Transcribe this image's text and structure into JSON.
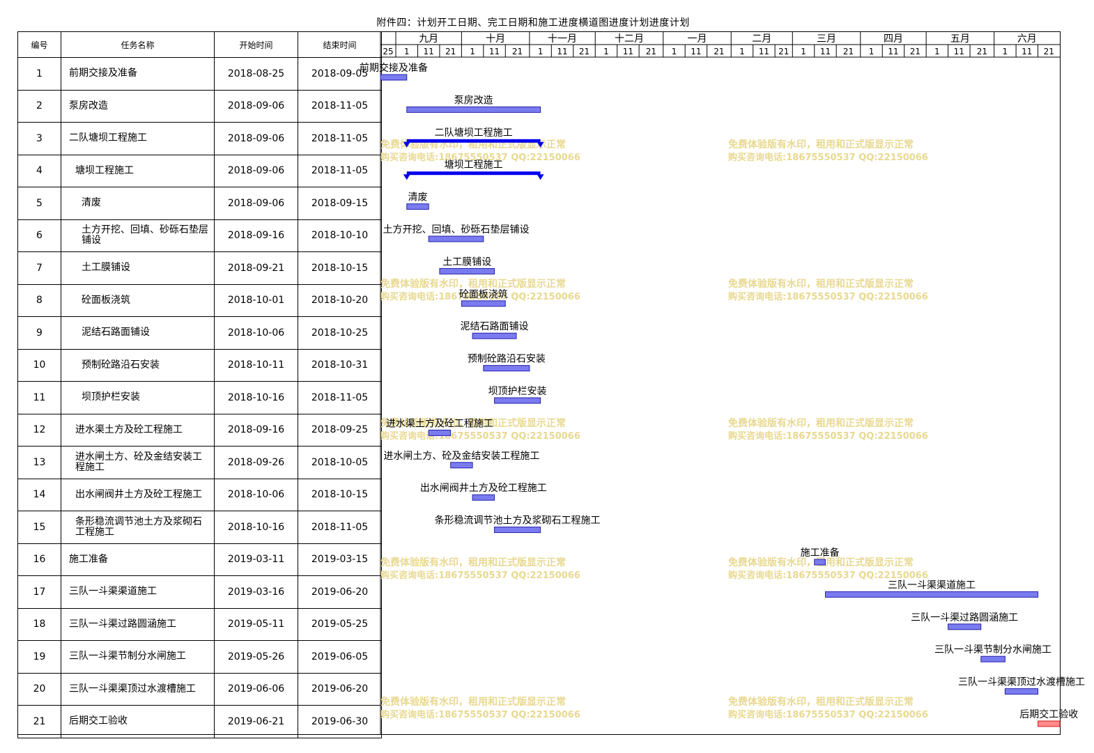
{
  "title": "附件四：计划开工日期、完工日期和施工进度横道图进度计划进度计划",
  "columns": {
    "id": "编号",
    "name": "任务名称",
    "start": "开始时间",
    "end": "结束时间"
  },
  "months": [
    "九月",
    "十月",
    "十一月",
    "十二月",
    "一月",
    "二月",
    "三月",
    "四月",
    "五月",
    "六月"
  ],
  "first_day_label": "25",
  "day_labels": [
    "1",
    "11",
    "21"
  ],
  "watermark": {
    "line1": "免费体验版有水印，租用和正式版显示正常",
    "line2": "购买咨询电话:18675550537 QQ:22150066"
  },
  "colors": {
    "task_bar": "#7b7bf0",
    "task_bar_border": "#2222aa",
    "summary_bar": "#0000ee",
    "final_bar": "#ff8a8a",
    "watermark": "#e8d890"
  },
  "tasks": [
    {
      "id": "1",
      "name": "前期交接及准备",
      "start": "2018-08-25",
      "end": "2018-09-05",
      "level": 0,
      "type": "task"
    },
    {
      "id": "2",
      "name": "泵房改造",
      "start": "2018-09-06",
      "end": "2018-11-05",
      "level": 0,
      "type": "task"
    },
    {
      "id": "3",
      "name": "二队塘坝工程施工",
      "start": "2018-09-06",
      "end": "2018-11-05",
      "level": 0,
      "type": "summary"
    },
    {
      "id": "4",
      "name": "塘坝工程施工",
      "start": "2018-09-06",
      "end": "2018-11-05",
      "level": 1,
      "type": "summary"
    },
    {
      "id": "5",
      "name": "清废",
      "start": "2018-09-06",
      "end": "2018-09-15",
      "level": 2,
      "type": "task"
    },
    {
      "id": "6",
      "name": "土方开挖、回填、砂砾石垫层铺设",
      "start": "2018-09-16",
      "end": "2018-10-10",
      "level": 2,
      "type": "task"
    },
    {
      "id": "7",
      "name": "土工膜铺设",
      "start": "2018-09-21",
      "end": "2018-10-15",
      "level": 2,
      "type": "task"
    },
    {
      "id": "8",
      "name": "砼面板浇筑",
      "start": "2018-10-01",
      "end": "2018-10-20",
      "level": 2,
      "type": "task"
    },
    {
      "id": "9",
      "name": "泥结石路面铺设",
      "start": "2018-10-06",
      "end": "2018-10-25",
      "level": 2,
      "type": "task"
    },
    {
      "id": "10",
      "name": "预制砼路沿石安装",
      "start": "2018-10-11",
      "end": "2018-10-31",
      "level": 2,
      "type": "task"
    },
    {
      "id": "11",
      "name": "坝顶护栏安装",
      "start": "2018-10-16",
      "end": "2018-11-05",
      "level": 2,
      "type": "task"
    },
    {
      "id": "12",
      "name": "进水渠土方及砼工程施工",
      "start": "2018-09-16",
      "end": "2018-09-25",
      "level": 1,
      "type": "task"
    },
    {
      "id": "13",
      "name": "进水闸土方、砼及金结安装工程施工",
      "start": "2018-09-26",
      "end": "2018-10-05",
      "level": 1,
      "type": "task"
    },
    {
      "id": "14",
      "name": "出水闸阀井土方及砼工程施工",
      "start": "2018-10-06",
      "end": "2018-10-15",
      "level": 1,
      "type": "task"
    },
    {
      "id": "15",
      "name": "条形稳流调节池土方及浆砌石工程施工",
      "start": "2018-10-16",
      "end": "2018-11-05",
      "level": 1,
      "type": "task"
    },
    {
      "id": "16",
      "name": "施工准备",
      "start": "2019-03-11",
      "end": "2019-03-15",
      "level": 0,
      "type": "task"
    },
    {
      "id": "17",
      "name": "三队一斗渠渠道施工",
      "start": "2019-03-16",
      "end": "2019-06-20",
      "level": 0,
      "type": "task"
    },
    {
      "id": "18",
      "name": "三队一斗渠过路圆涵施工",
      "start": "2019-05-11",
      "end": "2019-05-25",
      "level": 0,
      "type": "task"
    },
    {
      "id": "19",
      "name": "三队一斗渠节制分水闸施工",
      "start": "2019-05-26",
      "end": "2019-06-05",
      "level": 0,
      "type": "task"
    },
    {
      "id": "20",
      "name": "三队一斗渠渠顶过水渡槽施工",
      "start": "2019-06-06",
      "end": "2019-06-20",
      "level": 0,
      "type": "task"
    },
    {
      "id": "21",
      "name": "后期交工验收",
      "start": "2019-06-21",
      "end": "2019-06-30",
      "level": 0,
      "type": "final"
    }
  ],
  "chart_data": {
    "type": "gantt",
    "title": "附件四：计划开工日期、完工日期和施工进度横道图进度计划进度计划",
    "x_range": [
      "2018-08-25",
      "2019-06-30"
    ],
    "tasks": [
      {
        "name": "前期交接及准备",
        "start": "2018-08-25",
        "end": "2018-09-05"
      },
      {
        "name": "泵房改造",
        "start": "2018-09-06",
        "end": "2018-11-05"
      },
      {
        "name": "二队塘坝工程施工",
        "start": "2018-09-06",
        "end": "2018-11-05"
      },
      {
        "name": "塘坝工程施工",
        "start": "2018-09-06",
        "end": "2018-11-05"
      },
      {
        "name": "清废",
        "start": "2018-09-06",
        "end": "2018-09-15"
      },
      {
        "name": "土方开挖、回填、砂砾石垫层铺设",
        "start": "2018-09-16",
        "end": "2018-10-10"
      },
      {
        "name": "土工膜铺设",
        "start": "2018-09-21",
        "end": "2018-10-15"
      },
      {
        "name": "砼面板浇筑",
        "start": "2018-10-01",
        "end": "2018-10-20"
      },
      {
        "name": "泥结石路面铺设",
        "start": "2018-10-06",
        "end": "2018-10-25"
      },
      {
        "name": "预制砼路沿石安装",
        "start": "2018-10-11",
        "end": "2018-10-31"
      },
      {
        "name": "坝顶护栏安装",
        "start": "2018-10-16",
        "end": "2018-11-05"
      },
      {
        "name": "进水渠土方及砼工程施工",
        "start": "2018-09-16",
        "end": "2018-09-25"
      },
      {
        "name": "进水闸土方、砼及金结安装工程施工",
        "start": "2018-09-26",
        "end": "2018-10-05"
      },
      {
        "name": "出水闸阀井土方及砼工程施工",
        "start": "2018-10-06",
        "end": "2018-10-15"
      },
      {
        "name": "条形稳流调节池土方及浆砌石工程施工",
        "start": "2018-10-16",
        "end": "2018-11-05"
      },
      {
        "name": "施工准备",
        "start": "2019-03-11",
        "end": "2019-03-15"
      },
      {
        "name": "三队一斗渠渠道施工",
        "start": "2019-03-16",
        "end": "2019-06-20"
      },
      {
        "name": "三队一斗渠过路圆涵施工",
        "start": "2019-05-11",
        "end": "2019-05-25"
      },
      {
        "name": "三队一斗渠节制分水闸施工",
        "start": "2019-05-26",
        "end": "2019-06-05"
      },
      {
        "name": "三队一斗渠渠顶过水渡槽施工",
        "start": "2019-06-06",
        "end": "2019-06-20"
      },
      {
        "name": "后期交工验收",
        "start": "2019-06-21",
        "end": "2019-06-30"
      }
    ]
  }
}
